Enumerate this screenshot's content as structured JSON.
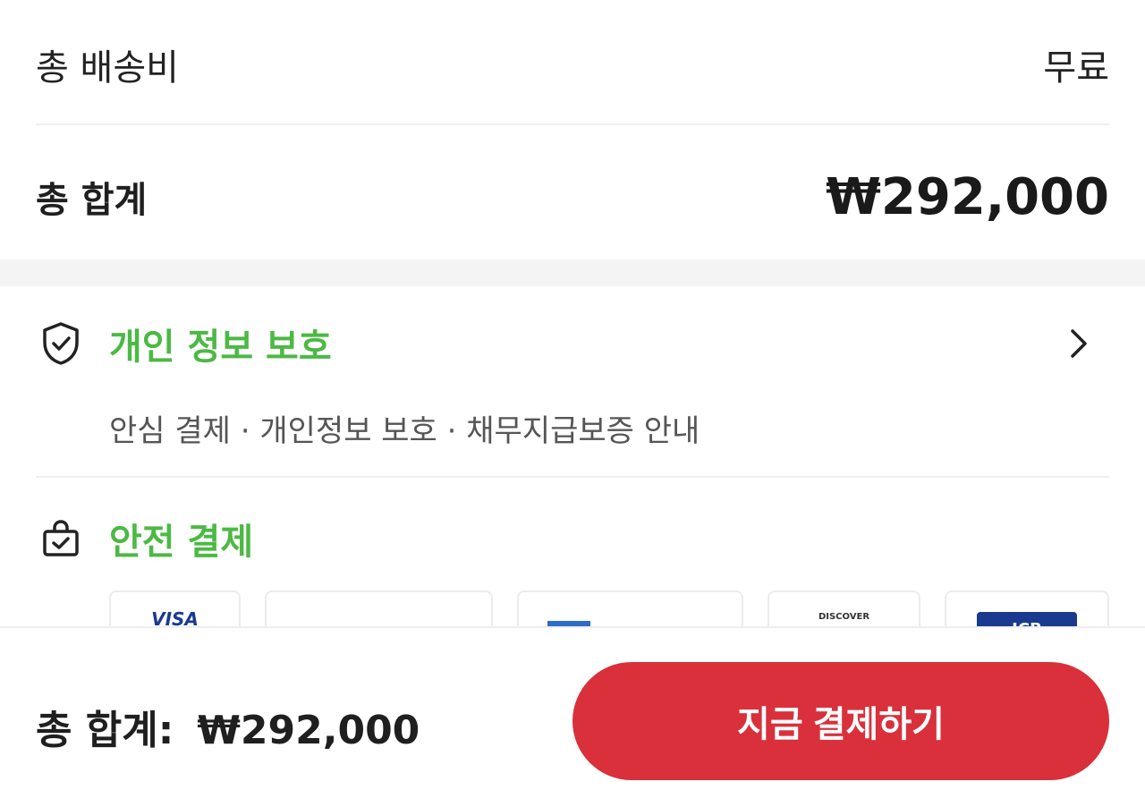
{
  "summary": {
    "shipping_label": "총 배송비",
    "shipping_value": "무료",
    "total_label": "총 합계",
    "total_amount": "₩292,000"
  },
  "privacy": {
    "icon": "shield-check-icon",
    "title": "개인 정보 보호",
    "description": "안심 결제 · 개인정보 보호 · 채무지급보증 안내"
  },
  "safe_payment": {
    "icon": "bag-check-icon",
    "title": "안전 결제",
    "cards": [
      {
        "name": "visa",
        "label": "VISA"
      },
      {
        "name": "mastercard",
        "label": ""
      },
      {
        "name": "amex",
        "label": ""
      },
      {
        "name": "discover",
        "label": "DISCOVER"
      },
      {
        "name": "jcb",
        "label": "JCB"
      }
    ]
  },
  "footer": {
    "total_label": "총 합계:",
    "total_amount": "₩292,000",
    "pay_button": "지금 결제하기"
  },
  "colors": {
    "accent_green": "#4cb944",
    "pay_red": "#d9303b"
  }
}
